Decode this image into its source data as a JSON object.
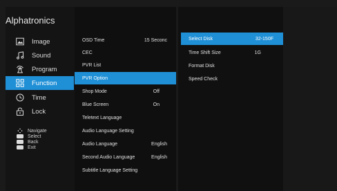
{
  "brand": "Alphatronics",
  "sidebar": {
    "items": [
      {
        "label": "Image",
        "icon": "image-icon"
      },
      {
        "label": "Sound",
        "icon": "music-note-icon"
      },
      {
        "label": "Program",
        "icon": "antenna-icon"
      },
      {
        "label": "Function",
        "icon": "grid-icon",
        "active": true
      },
      {
        "label": "Time",
        "icon": "clock-icon"
      },
      {
        "label": "Lock",
        "icon": "lock-icon"
      }
    ]
  },
  "help": {
    "navigate": "Navigate",
    "select": "Select",
    "back": "Back",
    "exit": "Exit"
  },
  "function_menu": {
    "items": [
      {
        "label": "OSD Time",
        "value": "15 Seconc"
      },
      {
        "label": "CEC",
        "value": ""
      },
      {
        "label": "PVR List",
        "value": ""
      },
      {
        "label": "PVR Option",
        "value": "",
        "active": true
      },
      {
        "label": "Shop Mode",
        "value": "Off"
      },
      {
        "label": "Blue Screen",
        "value": "On"
      },
      {
        "label": "Teletext Language",
        "value": ""
      },
      {
        "label": "Audio Language Setting",
        "value": ""
      },
      {
        "label": "Audio Language",
        "value": "English"
      },
      {
        "label": "Second Audio Language",
        "value": "English"
      },
      {
        "label": "Subtitle Language Setting",
        "value": ""
      }
    ]
  },
  "pvr_menu": {
    "items": [
      {
        "label": "Select Disk",
        "value": "32-150F",
        "active": true
      },
      {
        "label": "Time Shift Size",
        "value": "1G"
      },
      {
        "label": "Format Disk",
        "value": ""
      },
      {
        "label": "Speed Check",
        "value": ""
      }
    ]
  },
  "colors": {
    "accent": "#1f8fd6",
    "background": "#1a1a1a",
    "sidebar_bg": "#141414"
  }
}
